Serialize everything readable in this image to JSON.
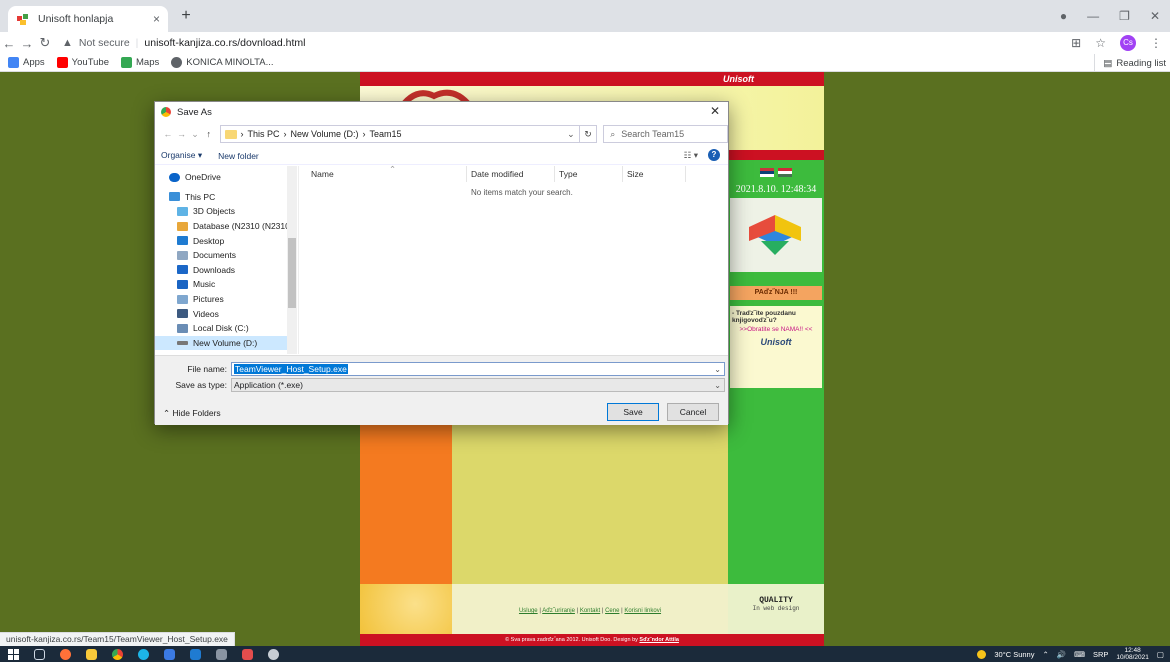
{
  "browser": {
    "tab_title": "Unisoft honlapja",
    "tab_close": "×",
    "new_tab": "+",
    "not_secure": "Not secure",
    "url": "unisoft-kanjiza.co.rs/dovnload.html",
    "profile_initials": "Cs",
    "bookmarks": [
      {
        "label": "Apps",
        "icon": "apps-grid-icon",
        "color": "#4285f4"
      },
      {
        "label": "YouTube",
        "icon": "youtube-icon",
        "color": "#ff0000"
      },
      {
        "label": "Maps",
        "icon": "maps-icon",
        "color": "#34a853"
      },
      {
        "label": "KONICA MINOLTA...",
        "icon": "globe-icon",
        "color": "#5f6368"
      }
    ],
    "reading_list": "Reading list",
    "status_url": "unisoft-kanjiza.co.rs/Team15/TeamViewer_Host_Setup.exe"
  },
  "site": {
    "brand": "Unisoft",
    "datetime": "2021.8.10. 12:48:34",
    "news_label": "PAďz˝NJA !!!",
    "ad_title": "- Traďz˝ite pouzdanu knjigovoďz˝u?",
    "ad_cta": ">>Obratite se NAMA!! <<",
    "ad_logo": "Unisoft",
    "footer_links": [
      "Usluge",
      "Aďz˝uriranje",
      "Kontakt",
      "Cene",
      "Korisni linkovi"
    ],
    "footer_sep": " | ",
    "quality_title": "QUALITY",
    "quality_sub": "In web design",
    "copyright_text": "© Sva prava zadrďz˝ana 2012. Unisoft Doo. Design by",
    "copyright_author": "Sďz˝ndor Attila",
    "colors": {
      "red": "#cc1122",
      "orange": "#f47a20",
      "green": "#3dbb3d",
      "olive": "#5a7020"
    }
  },
  "dialog": {
    "title": "Save As",
    "path": [
      "This PC",
      "New Volume (D:)",
      "Team15"
    ],
    "search_placeholder": "Search Team15",
    "organise": "Organise ▾",
    "new_folder": "New folder",
    "nav_items": [
      {
        "label": "OneDrive",
        "icon": "onedrive-icon",
        "color": "#0a64c9",
        "level": 0
      },
      {
        "label": "This PC",
        "icon": "computer-icon",
        "color": "#3a8fd8",
        "level": 0
      },
      {
        "label": "3D Objects",
        "icon": "3d-objects-icon",
        "color": "#5fb3e5",
        "level": 1
      },
      {
        "label": "Database (N2310 (N2310))",
        "icon": "network-drive-icon",
        "color": "#e8a73a",
        "level": 1
      },
      {
        "label": "Desktop",
        "icon": "desktop-icon",
        "color": "#1f7bd1",
        "level": 1
      },
      {
        "label": "Documents",
        "icon": "documents-icon",
        "color": "#8fa7c2",
        "level": 1
      },
      {
        "label": "Downloads",
        "icon": "downloads-icon",
        "color": "#1b67c7",
        "level": 1
      },
      {
        "label": "Music",
        "icon": "music-icon",
        "color": "#1a64c3",
        "level": 1
      },
      {
        "label": "Pictures",
        "icon": "pictures-icon",
        "color": "#7fa7cf",
        "level": 1
      },
      {
        "label": "Videos",
        "icon": "videos-icon",
        "color": "#3d5a80",
        "level": 1
      },
      {
        "label": "Local Disk (C:)",
        "icon": "local-disk-icon",
        "color": "#6a8db5",
        "level": 1
      },
      {
        "label": "New Volume (D:)",
        "icon": "drive-icon",
        "color": "#777777",
        "level": 1,
        "selected": true
      }
    ],
    "columns": [
      "Name",
      "Date modified",
      "Type",
      "Size"
    ],
    "empty_message": "No items match your search.",
    "file_name_label": "File name:",
    "file_name_value": "TeamViewer_Host_Setup.exe",
    "save_type_label": "Save as type:",
    "save_type_value": "Application (*.exe)",
    "hide_folders": "Hide Folders",
    "save_button": "Save",
    "cancel_button": "Cancel"
  },
  "taskbar": {
    "apps": [
      {
        "icon": "windows-start-icon",
        "color": "#ffffff"
      },
      {
        "icon": "task-view-icon",
        "color": "#cfd8e3"
      },
      {
        "icon": "firefox-icon",
        "color": "#ff7139"
      },
      {
        "icon": "file-explorer-icon",
        "color": "#f8c93a"
      },
      {
        "icon": "chrome-icon",
        "color": "#34a853"
      },
      {
        "icon": "edge-icon",
        "color": "#1db4e6"
      },
      {
        "icon": "store-icon",
        "color": "#3b7ae3"
      },
      {
        "icon": "mail-icon",
        "color": "#1f7bd1"
      },
      {
        "icon": "terminal-icon",
        "color": "#8a95a3"
      },
      {
        "icon": "teamviewer-icon",
        "color": "#e44d4d"
      },
      {
        "icon": "settings-icon",
        "color": "#c7cdd4"
      }
    ],
    "weather": "30°C Sunny",
    "lang": "SRP",
    "time": "12:48",
    "date": "10/08/2021"
  }
}
